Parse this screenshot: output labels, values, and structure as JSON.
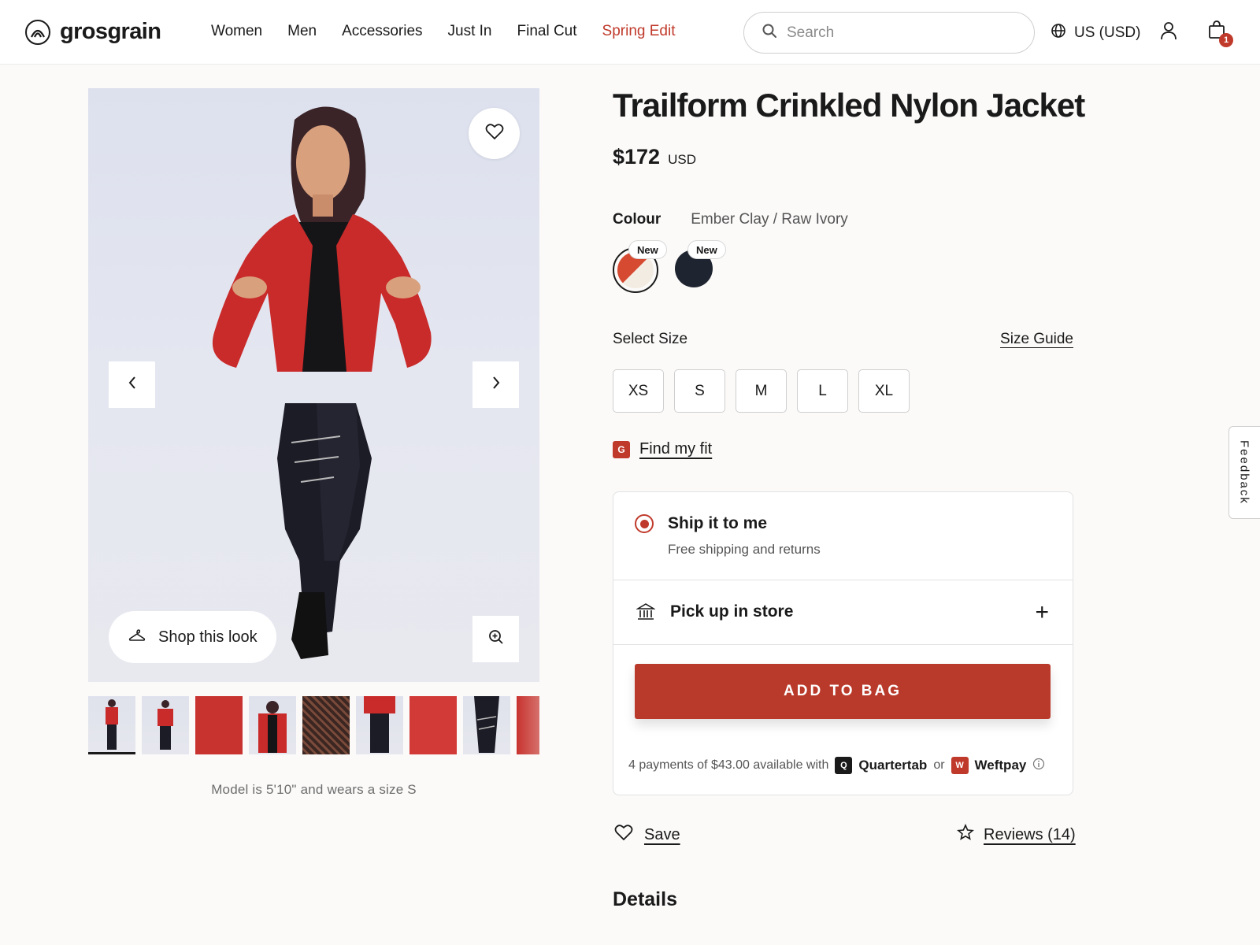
{
  "header": {
    "logo": "grosgrain",
    "nav": [
      {
        "label": "Women"
      },
      {
        "label": "Men"
      },
      {
        "label": "Accessories"
      },
      {
        "label": "Just In"
      },
      {
        "label": "Final Cut"
      },
      {
        "label": "Spring Edit",
        "accent": true
      }
    ],
    "search_placeholder": "Search",
    "region": "US (USD)",
    "bag_count": "1"
  },
  "gallery": {
    "shop_look": "Shop this look",
    "model_note": "Model is 5'10\" and wears a size S",
    "thumbnail_count": 9
  },
  "product": {
    "title": "Trailform Crinkled Nylon Jacket",
    "price": "$172",
    "currency": "USD",
    "colour_label": "Colour",
    "colour_value": "Ember Clay / Raw Ivory",
    "swatches": [
      {
        "badge": "New",
        "color": "#d64a32"
      },
      {
        "badge": "New",
        "color": "#1e2430"
      }
    ],
    "size_label": "Select Size",
    "size_guide": "Size Guide",
    "sizes": [
      "XS",
      "S",
      "M",
      "L",
      "XL"
    ],
    "fit_badge": "G",
    "find_fit": "Find my fit"
  },
  "shipping": {
    "ship_title": "Ship it to me",
    "ship_sub": "Free shipping and returns",
    "pickup_title": "Pick up in store",
    "add_to_bag": "ADD TO BAG",
    "installments": {
      "text": "4 payments of $43.00 available with",
      "provider1": "Quartertab",
      "provider1_badge": "Q",
      "or": "or",
      "provider2": "Weftpay",
      "provider2_badge": "W"
    }
  },
  "actions": {
    "save": "Save",
    "reviews": "Reviews (14)"
  },
  "details_heading": "Details",
  "feedback": "Feedback",
  "colors": {
    "accent": "#c03a2b",
    "button": "#b93a2b"
  }
}
